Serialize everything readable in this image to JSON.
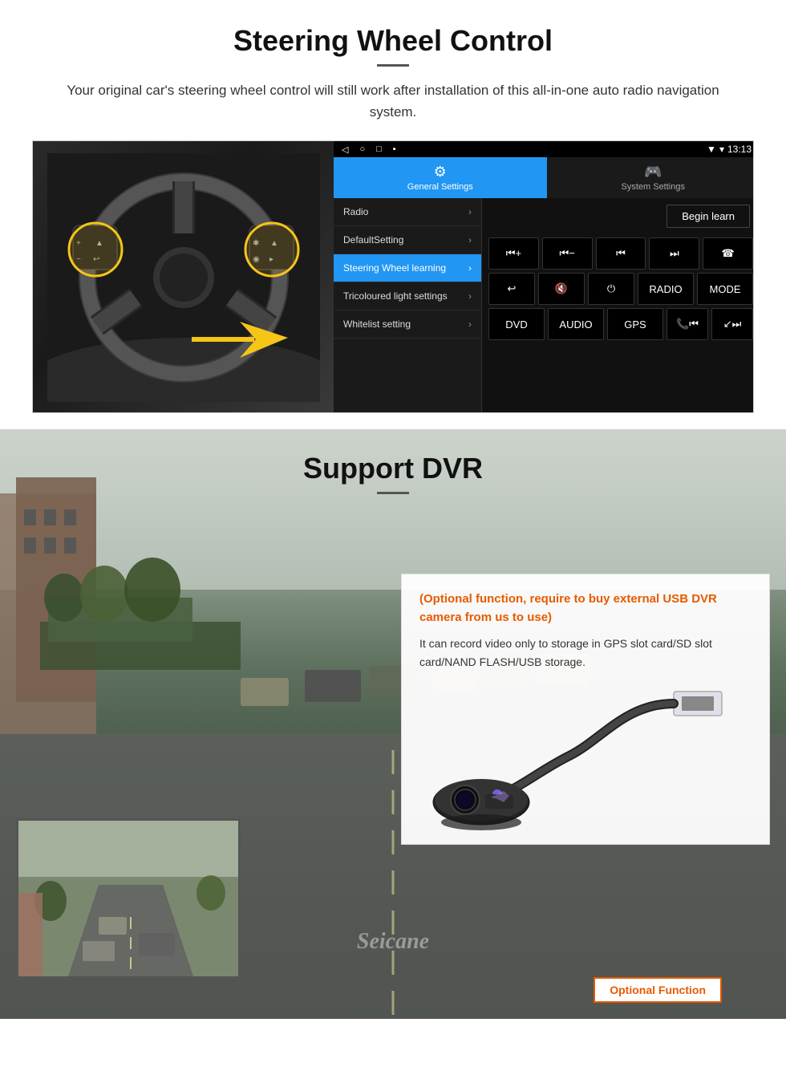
{
  "section1": {
    "title": "Steering Wheel Control",
    "description": "Your original car's steering wheel control will still work after installation of this all-in-one auto radio navigation system.",
    "status_bar": {
      "left_icons": [
        "◁",
        "○",
        "□",
        "▪"
      ],
      "time": "13:13",
      "signal": "▼",
      "wifi": "▾"
    },
    "tabs": [
      {
        "label": "General Settings",
        "icon": "⚙",
        "active": true
      },
      {
        "label": "System Settings",
        "icon": "🎮",
        "active": false
      }
    ],
    "menu_items": [
      {
        "label": "Radio",
        "active": false,
        "has_chevron": true
      },
      {
        "label": "DefaultSetting",
        "active": false,
        "has_chevron": true
      },
      {
        "label": "Steering Wheel learning",
        "active": true,
        "has_chevron": true
      },
      {
        "label": "Tricoloured light settings",
        "active": false,
        "has_chevron": true
      },
      {
        "label": "Whitelist setting",
        "active": false,
        "has_chevron": true
      }
    ],
    "begin_learn_label": "Begin learn",
    "control_buttons": {
      "row1": [
        "⏮+",
        "⏮−",
        "⏮⏮",
        "⏭⏭",
        "☎"
      ],
      "row2": [
        "↩",
        "🔇",
        "⏻",
        "RADIO",
        "MODE"
      ],
      "row3": [
        "DVD",
        "AUDIO",
        "GPS",
        "📞⏮",
        "↙⏭"
      ]
    }
  },
  "section2": {
    "title": "Support DVR",
    "optional_text": "(Optional function, require to buy external USB DVR camera from us to use)",
    "description": "It can record video only to storage in GPS slot card/SD slot card/NAND FLASH/USB storage.",
    "optional_badge_label": "Optional Function",
    "seicane_label": "Seicane"
  }
}
